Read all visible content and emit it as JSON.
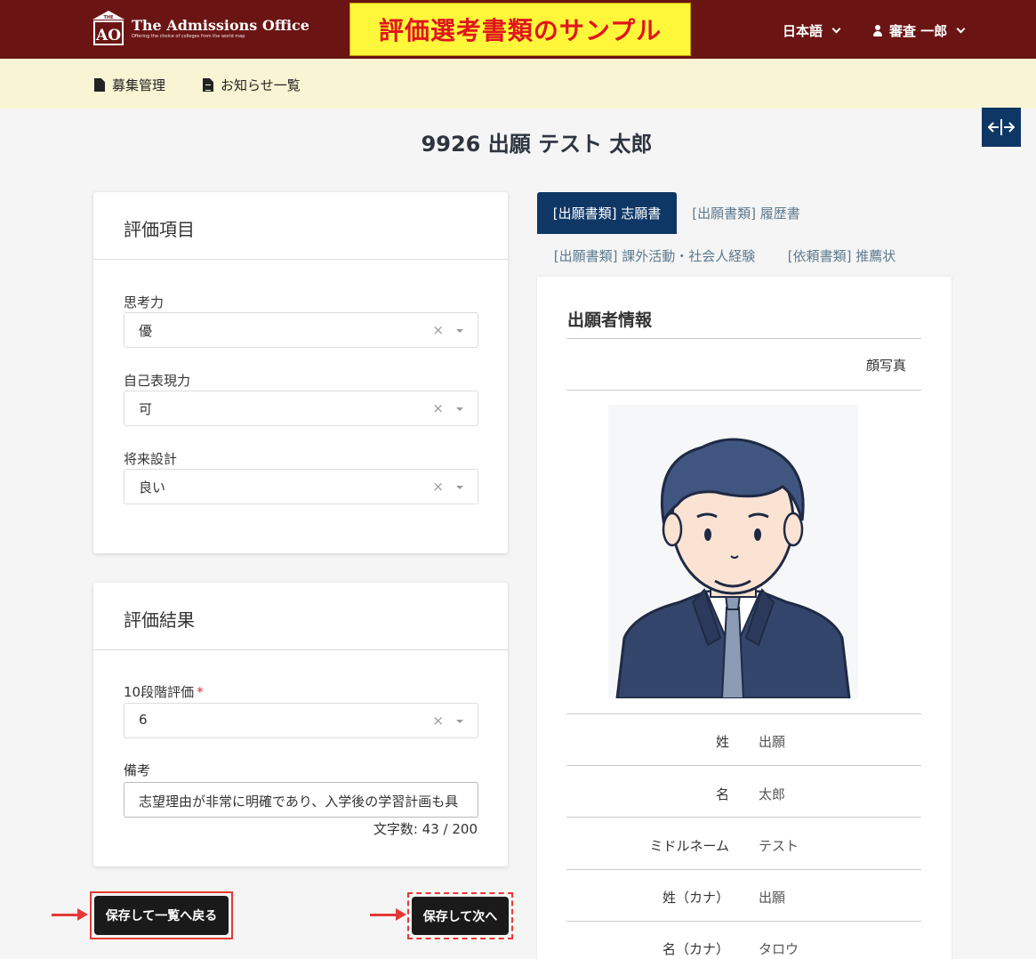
{
  "header": {
    "logo_title": "The Admissions Office",
    "logo_subtitle": "Offering the choice of colleges from the world map",
    "logo_mark_top": "THE",
    "logo_mark_letters": "AO",
    "sample_banner": "評価選考書類のサンプル",
    "language": "日本語",
    "user_name": "審査 一郎"
  },
  "subnav": {
    "items": [
      {
        "label": "募集管理",
        "icon": "file-icon"
      },
      {
        "label": "お知らせ一覧",
        "icon": "file-lines-icon"
      }
    ]
  },
  "page": {
    "title": "9926 出願 テスト 太郎",
    "expand_icon": "←|→"
  },
  "evaluation_items": {
    "heading": "評価項目",
    "fields": [
      {
        "label": "思考力",
        "value": "優"
      },
      {
        "label": "自己表現力",
        "value": "可"
      },
      {
        "label": "将来設計",
        "value": "良い"
      }
    ]
  },
  "evaluation_result": {
    "heading": "評価結果",
    "rating_label": "10段階評価",
    "required_mark": "*",
    "rating_value": "6",
    "remarks_label": "備考",
    "remarks_value": "志望理由が非常に明確であり、入学後の学習計画も具",
    "char_count_label": "文字数:",
    "char_count": "43",
    "char_max": "200"
  },
  "actions": {
    "save_back": "保存して一覧へ戻る",
    "save_next": "保存して次へ"
  },
  "tabs": [
    {
      "label": "[出願書類] 志願書",
      "active": true
    },
    {
      "label": "[出願書類] 履歴書",
      "active": false
    },
    {
      "label": "[出願書類] 課外活動・社会人経験",
      "active": false
    },
    {
      "label": "[依頼書類] 推薦状",
      "active": false
    }
  ],
  "applicant": {
    "heading": "出願者情報",
    "photo_label": "顔写真",
    "rows": [
      {
        "key": "姓",
        "value": "出願"
      },
      {
        "key": "名",
        "value": "太郎"
      },
      {
        "key": "ミドルネーム",
        "value": "テスト"
      },
      {
        "key": "姓（カナ）",
        "value": "出願"
      },
      {
        "key": "名（カナ）",
        "value": "タロウ"
      }
    ]
  },
  "colors": {
    "header_bg": "#6b1414",
    "subnav_bg": "#f9f4d4",
    "accent_navy": "#0f3766",
    "banner_yellow": "#fff83a",
    "banner_text": "#e0161c",
    "highlight_red": "#e53935"
  }
}
